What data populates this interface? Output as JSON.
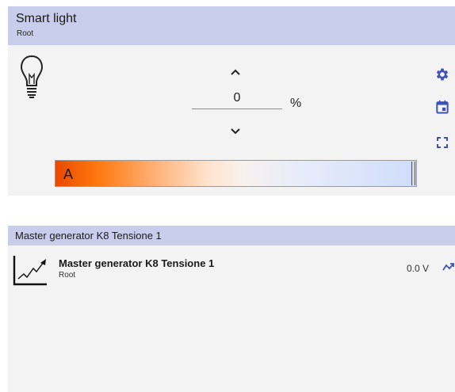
{
  "smart_light": {
    "title": "Smart light",
    "subtitle": "Root",
    "value": "0",
    "unit": "%",
    "bar_label": "A",
    "level": 0,
    "icons": {
      "bulb": "lightbulb-icon",
      "up": "chevron-up-icon",
      "down": "chevron-down-icon",
      "settings": "gear-icon",
      "schedule": "calendar-icon",
      "fullscreen": "fullscreen-icon"
    },
    "colors": {
      "header": "#c7cdea",
      "accent": "#3f51b5",
      "gradient_start": "#e84a00",
      "gradient_end": "#cfdcfa"
    }
  },
  "generator": {
    "header_title": "Master generator K8 Tensione 1",
    "item_title": "Master generator K8 Tensione 1",
    "item_subtitle": "Root",
    "reading": "0.0 V",
    "icons": {
      "chart": "line-chart-icon",
      "trend": "trend-icon"
    }
  }
}
